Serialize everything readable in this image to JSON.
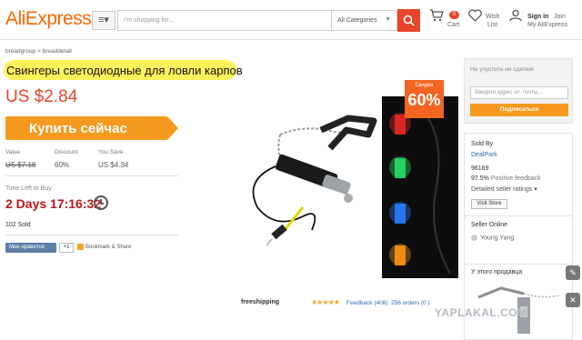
{
  "header": {
    "logo": "AliExpress",
    "search_placeholder": "I'm shopping for...",
    "category_select": "All Categories",
    "cart_count": "0",
    "cart_label": "Cart",
    "wish_label_1": "Wish",
    "wish_label_2": "List",
    "signin_label": "Sign in",
    "join_label": "Join",
    "account_label": "My AliExpress"
  },
  "breadcrumb": "breadgroup > breaddetail",
  "product": {
    "title": "Свингеры светодиодные для ловли карпов",
    "price": "US $2.84",
    "buy_label": "Купить сейчас",
    "stats": {
      "value_label": "Value",
      "value": "US $7.18",
      "discount_label": "Discount",
      "discount": "60%",
      "save_label": "You Save",
      "save": "US $4.34"
    },
    "time_left_label": "Time Left to Buy",
    "time_left": "2 Days 17:16:32",
    "sold": "102 Sold",
    "sale_label": "Скидка",
    "sale_percent": "60%",
    "shipping": "freeshipping",
    "stars": "★★★★★",
    "feedback": "Feedback (406)",
    "orders": "256 orders (0 )"
  },
  "share": {
    "vk_label": "Мне нравится",
    "plus_label": "+1",
    "bookmark_label": "Bookmark & Share"
  },
  "promo": {
    "title": "Не упустите ни сделки!",
    "email_placeholder": "Введите адрес эл. почты...",
    "subscribe_label": "Подписаться"
  },
  "seller": {
    "sold_by_label": "Sold By",
    "store_name": "DealPark",
    "score": "96169",
    "positive": "97.5%",
    "positive_label": "Positive feedback",
    "detailed_label": "Detailed seller ratings",
    "visit_label": "Visit Store",
    "online_label": "Seller Online",
    "agent_name": "Young Yang"
  },
  "more_from_seller": "У этого продавца",
  "watermark": "YAPLAKAL.COM",
  "colors": {
    "brand": "#ff6600",
    "price": "#e8452c",
    "buy_button": "#f59a1e",
    "highlight": "#fff25a",
    "timer": "#c0161c"
  }
}
